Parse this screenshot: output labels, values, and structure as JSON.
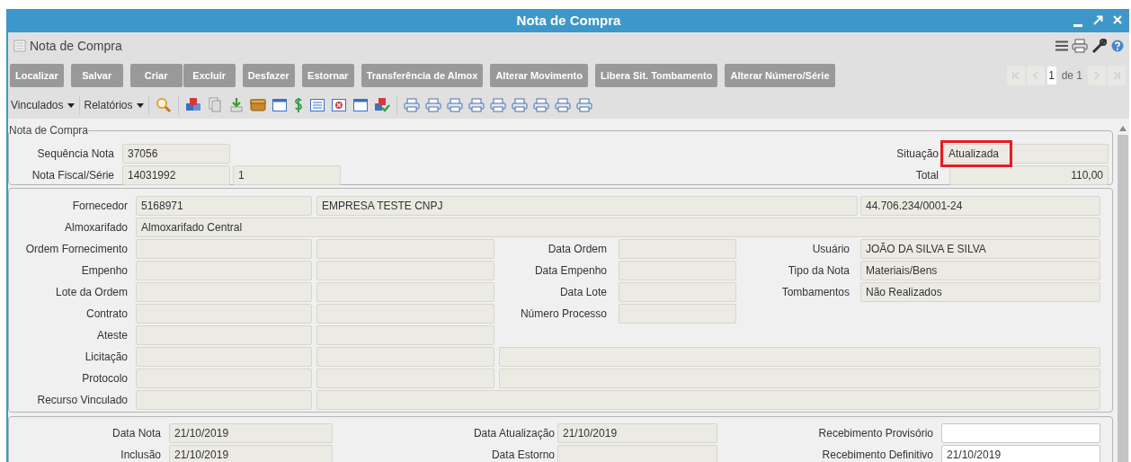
{
  "window": {
    "title": "Nota de Compra"
  },
  "header": {
    "title": "Nota de Compra"
  },
  "button_groups": [
    {
      "buttons": [
        "Localizar"
      ]
    },
    {
      "buttons": [
        "Salvar"
      ]
    },
    {
      "buttons": [
        "Criar",
        "Excluir"
      ]
    },
    {
      "buttons": [
        "Desfazer"
      ]
    },
    {
      "buttons": [
        "Estornar"
      ]
    },
    {
      "buttons": [
        "Transferência de Almox"
      ]
    },
    {
      "buttons": [
        "Alterar Movimento"
      ]
    },
    {
      "buttons": [
        "Libera Sit. Tombamento"
      ]
    },
    {
      "buttons": [
        "Alterar Número/Série"
      ]
    }
  ],
  "pager": {
    "page": "1",
    "count": "de 1",
    "nav": [
      {
        "kind": "first",
        "disabled": true
      },
      {
        "kind": "previous",
        "disabled": true
      },
      {
        "kind": "next",
        "disabled": true
      },
      {
        "kind": "last",
        "disabled": true
      }
    ]
  },
  "menus": [
    "Vinculados",
    "Relatórios"
  ],
  "summary": {
    "legend": "Nota de Compra",
    "sequence": {
      "label": "Sequência Nota",
      "value": "37056"
    },
    "invoice": {
      "label": "Nota Fiscal/Série",
      "number": "14031992",
      "series": "1"
    },
    "status": {
      "label": "Situação",
      "value": "Atualizada",
      "highlighted": true
    },
    "total": {
      "label": "Total",
      "value": "110,00"
    }
  },
  "details": [
    {
      "kind": "supplier",
      "label": "Fornecedor",
      "fields": [
        {
          "value": "5168971"
        },
        {
          "value": "EMPRESA TESTE CNPJ"
        },
        {
          "value": "44.706.234/0001-24"
        }
      ]
    },
    {
      "kind": "wide",
      "label": "Almoxarifado",
      "fields": [
        {
          "value": "Almoxarifado Central"
        }
      ]
    },
    {
      "kind": "detail",
      "label": "Ordem Fornecimento",
      "middle": {
        "label": "Data Ordem"
      },
      "right": {
        "label": "Usuário",
        "value": "JOÃO DA SILVA E SILVA"
      }
    },
    {
      "kind": "detail",
      "label": "Empenho",
      "middle": {
        "label": "Data Empenho"
      },
      "right": {
        "label": "Tipo da Nota",
        "value": "Materiais/Bens"
      }
    },
    {
      "kind": "detail",
      "label": "Lote da Ordem",
      "middle": {
        "label": "Data Lote"
      },
      "right": {
        "label": "Tombamentos",
        "value": "Não Realizados"
      }
    },
    {
      "kind": "detail",
      "label": "Contrato",
      "middle": {
        "label": "Número Processo"
      }
    },
    {
      "kind": "detail",
      "label": "Ateste"
    },
    {
      "kind": "triple",
      "label": "Licitação"
    },
    {
      "kind": "triple",
      "label": "Protocolo"
    },
    {
      "kind": "linked",
      "label": "Recurso Vinculado"
    }
  ],
  "dates": [
    {
      "cells": [
        {
          "label": "Data Nota",
          "value": "21/10/2019",
          "editable": false
        },
        {
          "label": "Data Atualização",
          "value": "21/10/2019",
          "editable": false
        },
        {
          "label": "Recebimento Provisório",
          "editable": true
        }
      ]
    },
    {
      "cells": [
        {
          "label": "Inclusão",
          "value": "21/10/2019",
          "editable": false
        },
        {
          "label": "Data Estorno",
          "editable": false
        },
        {
          "label": "Recebimento Definitivo",
          "value": "21/10/2019",
          "editable": true
        }
      ]
    }
  ]
}
